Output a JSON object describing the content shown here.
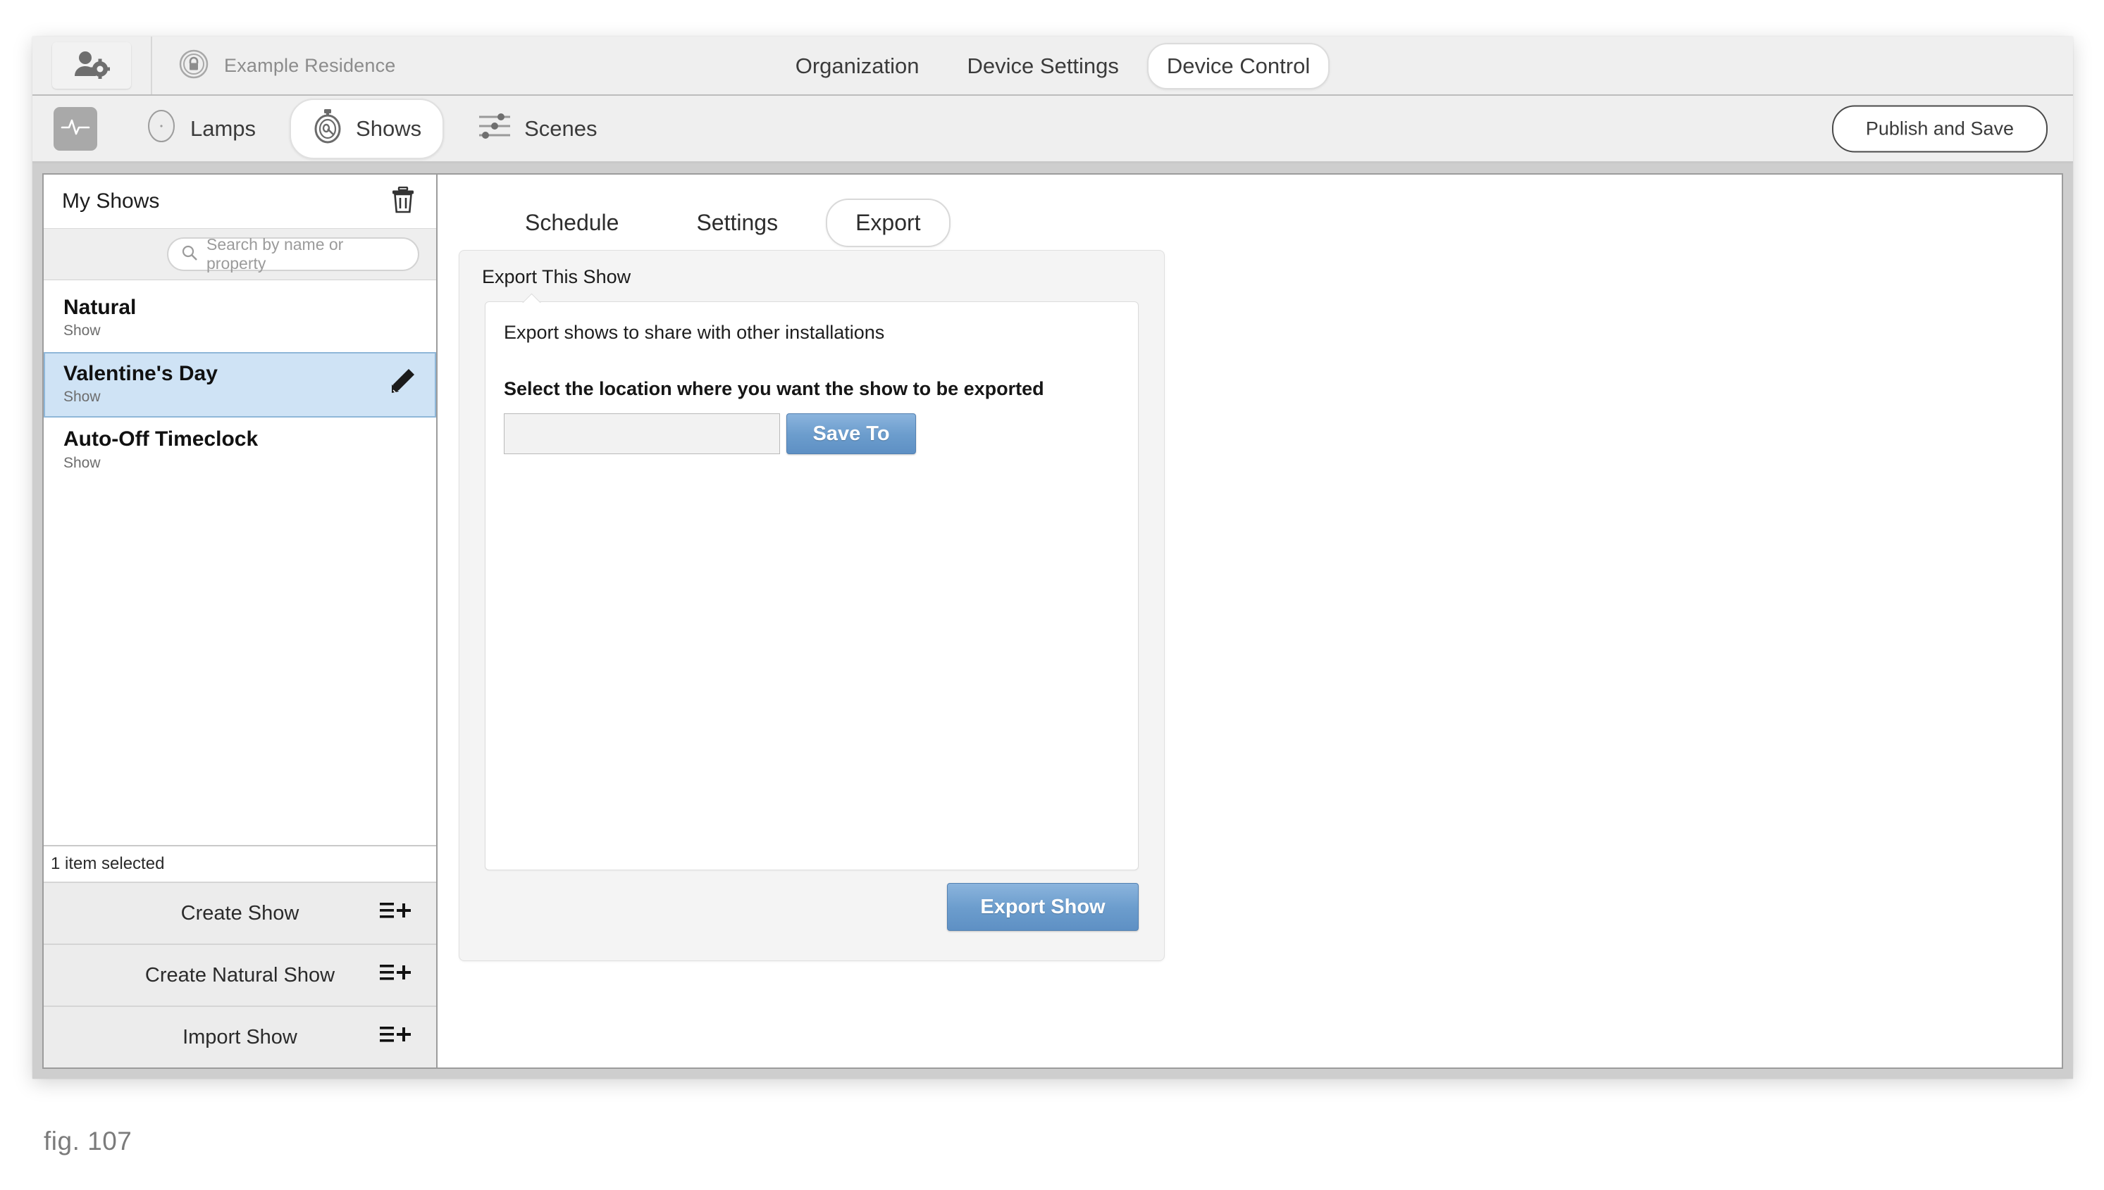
{
  "window": {
    "topbar": {
      "user_icon": "user-settings-icon",
      "lock_icon": "lock-badge-icon",
      "residence_name": "Example Residence",
      "tabs": [
        {
          "label": "Organization",
          "active": false
        },
        {
          "label": "Device Settings",
          "active": false
        },
        {
          "label": "Device Control",
          "active": true
        }
      ]
    },
    "subbar": {
      "pulse_icon": "activity-pulse-icon",
      "segments": [
        {
          "label": "Lamps",
          "icon": "lamp-circle-icon",
          "active": false
        },
        {
          "label": "Shows",
          "icon": "stopwatch-icon",
          "active": true
        },
        {
          "label": "Scenes",
          "icon": "sliders-icon",
          "active": false
        }
      ],
      "publish_label": "Publish and Save"
    }
  },
  "sidebar": {
    "title": "My Shows",
    "delete_icon": "trash-icon",
    "search": {
      "placeholder": "Search by name or property",
      "value": "",
      "icon": "search-icon"
    },
    "items": [
      {
        "name": "Natural",
        "type": "Show",
        "selected": false
      },
      {
        "name": "Valentine's Day",
        "type": "Show",
        "selected": true,
        "edit_icon": "pencil-icon"
      },
      {
        "name": "Auto-Off Timeclock",
        "type": "Show",
        "selected": false
      }
    ],
    "status": "1 item selected",
    "actions": [
      {
        "label": "Create Show",
        "icon": "list-add-icon"
      },
      {
        "label": "Create Natural Show",
        "icon": "list-add-icon"
      },
      {
        "label": "Import Show",
        "icon": "list-add-icon"
      }
    ]
  },
  "main": {
    "tabs": [
      {
        "label": "Schedule",
        "active": false
      },
      {
        "label": "Settings",
        "active": false
      },
      {
        "label": "Export",
        "active": true
      }
    ],
    "panel": {
      "title": "Export This Show",
      "description": "Export shows to share with other installations",
      "field_label": "Select the location where you want the show to be exported",
      "path_value": "",
      "save_to_label": "Save To",
      "export_label": "Export Show"
    }
  },
  "caption": "fig. 107",
  "colors": {
    "accent_blue": "#6c9dcd",
    "selection_blue": "#cfe3f5",
    "chrome_gray": "#efefef"
  }
}
